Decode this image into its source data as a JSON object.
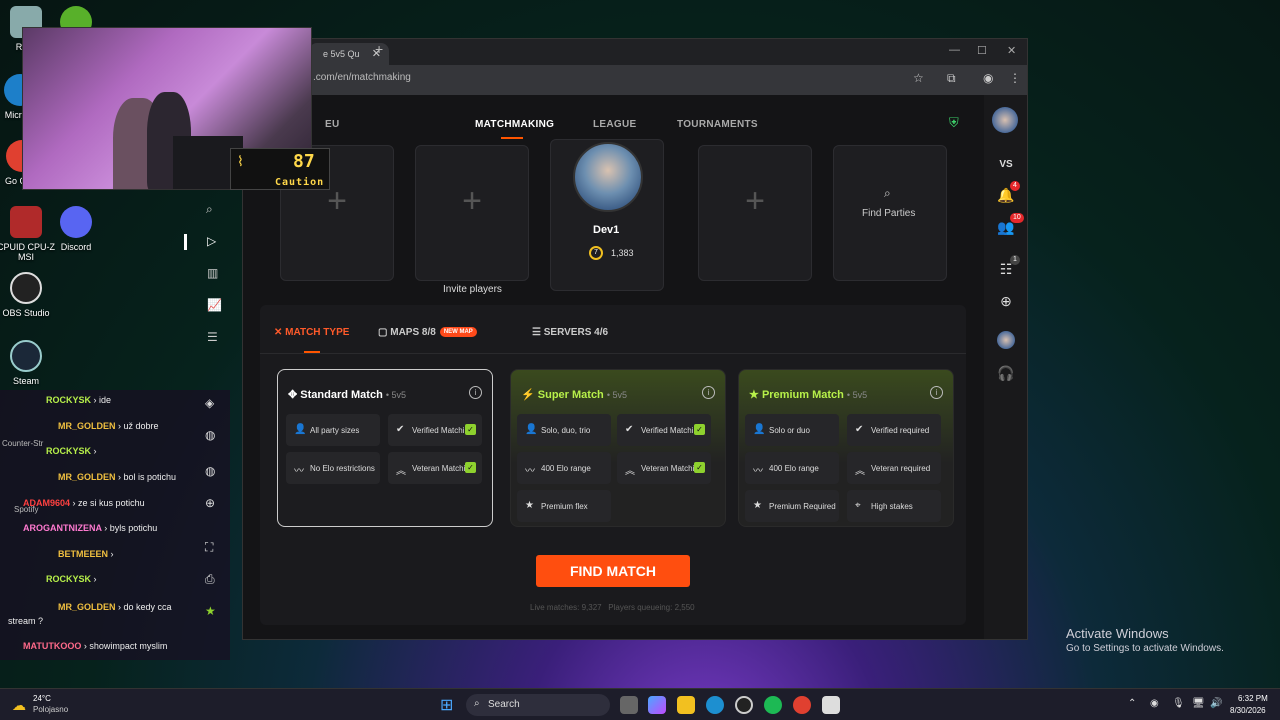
{
  "desktop": {
    "icons": [
      {
        "label": "Recy"
      },
      {
        "label": "Micr Ed"
      },
      {
        "label": "Go Chro"
      },
      {
        "label": "CPUID CPU-Z MSI"
      },
      {
        "label": "Discord"
      },
      {
        "label": "OBS Studio"
      },
      {
        "label": "Steam"
      },
      {
        "label": "Counter-Str"
      },
      {
        "label": "Spotify"
      }
    ]
  },
  "webcam_overlay": {
    "gauge_value": "87",
    "gauge_label": "Caution"
  },
  "browser": {
    "tab_title": "e 5v5 Qu",
    "url": ".com/en/matchmaking"
  },
  "app": {
    "region": "EU",
    "nav": [
      "MATCHMAKING",
      "LEAGUE",
      "TOURNAMENTS"
    ],
    "party": {
      "invite_label": "Invite players",
      "player_name": "Dev1",
      "player_level": "7",
      "player_elo": "1,383",
      "find_parties": "Find Parties"
    },
    "tabs": {
      "match_type": "MATCH TYPE",
      "maps": "MAPS 8/8",
      "new_map": "NEW MAP",
      "servers": "SERVERS 4/6"
    },
    "cards": {
      "standard": {
        "title": "Standard Match",
        "mode": "• 5v5",
        "f1": "All party sizes",
        "f2": "Verified Matching",
        "f3": "No Elo restrictions",
        "f4": "Veteran Matching"
      },
      "super": {
        "title": "Super Match",
        "mode": "• 5v5",
        "f1": "Solo, duo, trio",
        "f2": "Verified Matching",
        "f3": "400 Elo range",
        "f4": "Veteran Matching",
        "f5": "Premium flex"
      },
      "premium": {
        "title": "Premium Match",
        "mode": "• 5v5",
        "f1": "Solo or duo",
        "f2": "Verified required",
        "f3": "400 Elo range",
        "f4": "Veteran required",
        "f5": "Premium Required",
        "f6": "High stakes"
      }
    },
    "find_match": "FIND MATCH",
    "stats": {
      "live_label": "Live matches:",
      "live": "9,327",
      "queue_label": "Players queueing:",
      "queue": "2,550"
    },
    "rail": {
      "vs": "VS",
      "notif_badge": "4",
      "friends_badge": "10",
      "party_badge": "1"
    }
  },
  "chat": [
    {
      "user": "ROCKYSK",
      "msg": "ide",
      "color": "#b7f04a"
    },
    {
      "user": "MR_GOLDEN",
      "msg": "už dobre",
      "color": "#f0c040"
    },
    {
      "user": "ROCKYSK",
      "msg": "",
      "color": "#b7f04a"
    },
    {
      "user": "MR_GOLDEN",
      "msg": "bol is potichu",
      "color": "#f0c040"
    },
    {
      "user": "ADAM9604",
      "msg": "ze si kus potichu",
      "color": "#ff4040"
    },
    {
      "user": "AROGANTNIZENA",
      "msg": "byls potichu",
      "color": "#ff7ad0"
    },
    {
      "user": "BETMEEEN",
      "msg": "",
      "color": "#f0c040"
    },
    {
      "user": "ROCKYSK",
      "msg": "",
      "color": "#b7f04a"
    },
    {
      "user": "MR_GOLDEN",
      "msg": "do kedy cca stream ?",
      "color": "#f0c040"
    },
    {
      "user": "MATUTKOOO",
      "msg": "showimpact myslim",
      "color": "#ff6a8a"
    }
  ],
  "taskbar": {
    "weather_temp": "24°C",
    "weather_desc": "Polojasno",
    "search": "Search",
    "time": "6:32 PM",
    "date": "8/30/2026"
  },
  "watermark": {
    "title": "Activate Windows",
    "sub": "Go to Settings to activate Windows."
  }
}
